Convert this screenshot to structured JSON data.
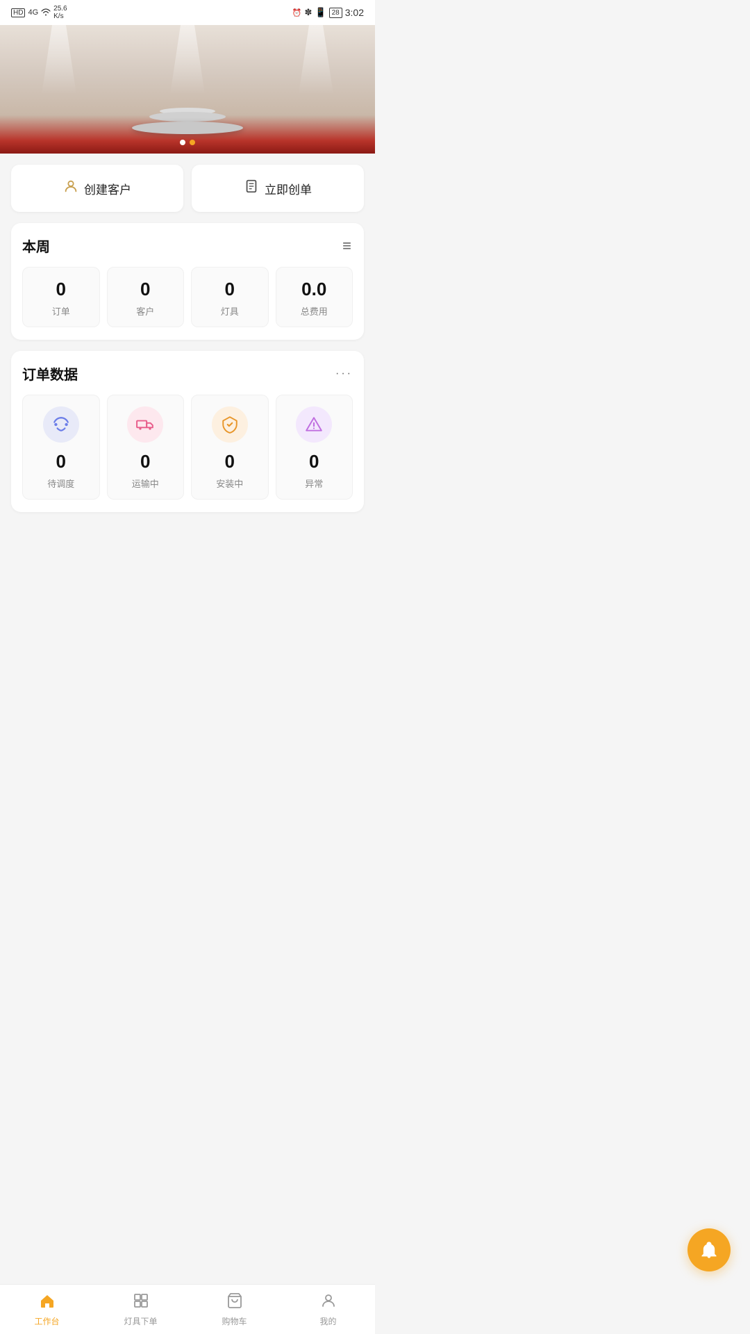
{
  "statusBar": {
    "left": "HD 4G 25.6K/s",
    "right": "3:02"
  },
  "banner": {
    "dots": [
      "white",
      "gold"
    ]
  },
  "quickActions": [
    {
      "id": "create-customer",
      "icon": "👤",
      "label": "创建客户"
    },
    {
      "id": "create-order",
      "icon": "📋",
      "label": "立即创单"
    }
  ],
  "thisWeek": {
    "title": "本周",
    "stats": [
      {
        "id": "orders",
        "value": "0",
        "label": "订单"
      },
      {
        "id": "customers",
        "value": "0",
        "label": "客户"
      },
      {
        "id": "lights",
        "value": "0",
        "label": "灯具"
      },
      {
        "id": "total-cost",
        "value": "0.0",
        "label": "总费用"
      }
    ]
  },
  "orderData": {
    "title": "订单数据",
    "items": [
      {
        "id": "pending",
        "icon": "📡",
        "iconClass": "icon-blue",
        "value": "0",
        "label": "待调度"
      },
      {
        "id": "in-transit",
        "icon": "🚛",
        "iconClass": "icon-pink",
        "value": "0",
        "label": "运输中"
      },
      {
        "id": "installing",
        "icon": "📦",
        "iconClass": "icon-orange",
        "value": "0",
        "label": "安装中"
      },
      {
        "id": "abnormal",
        "icon": "⚠️",
        "iconClass": "icon-purple",
        "value": "0",
        "label": "异常"
      }
    ]
  },
  "fab": {
    "icon": "🔔",
    "label": "notifications"
  },
  "bottomNav": [
    {
      "id": "workbench",
      "icon": "🏠",
      "label": "工作台",
      "active": true
    },
    {
      "id": "lights-order",
      "icon": "⊞",
      "label": "灯具下单",
      "active": false
    },
    {
      "id": "cart",
      "icon": "🛒",
      "label": "购物车",
      "active": false
    },
    {
      "id": "mine",
      "icon": "👤",
      "label": "我的",
      "active": false
    }
  ]
}
